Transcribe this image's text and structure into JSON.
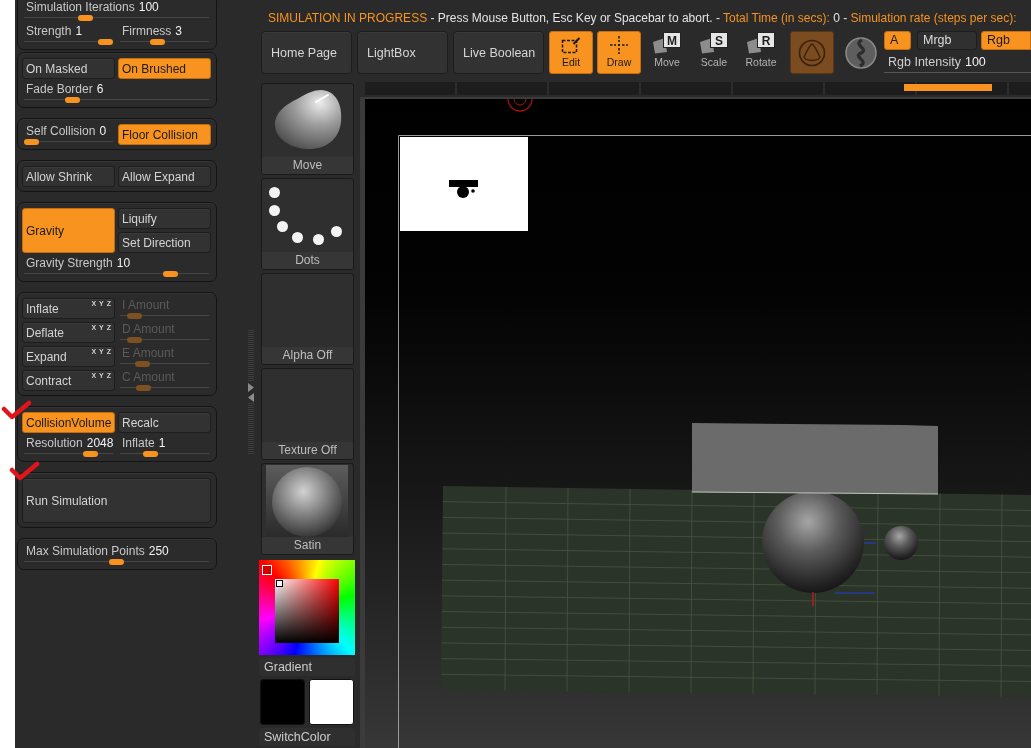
{
  "status_message": [
    {
      "text": "SIMULATION IN PROGRESS",
      "kind": "highlight"
    },
    {
      "text": "- Press Mouse Button, Esc Key or Spacebar to abort. -",
      "kind": "plain"
    },
    {
      "text": "Total Time (in secs):",
      "kind": "highlight"
    },
    {
      "text": "0 -",
      "kind": "plain"
    },
    {
      "text": "Simulation rate (steps per sec):",
      "kind": "highlight"
    }
  ],
  "toolbar": [
    {
      "kind": "link",
      "label": "Home Page"
    },
    {
      "kind": "link",
      "label": "LightBox"
    },
    {
      "kind": "link",
      "label": "Live Boolean"
    },
    {
      "kind": "edit",
      "label": "Edit",
      "selected": true
    },
    {
      "kind": "draw",
      "label": "Draw",
      "selected": true
    },
    {
      "kind": "transform",
      "label": "Move",
      "key": "M",
      "selected": false
    },
    {
      "kind": "transform",
      "label": "Scale",
      "key": "S",
      "selected": false
    },
    {
      "kind": "transform",
      "label": "Rotate",
      "key": "R",
      "selected": false
    },
    {
      "kind": "toggle",
      "selected": true,
      "disabled": true
    },
    {
      "kind": "orb"
    }
  ],
  "color_channels": [
    {
      "label": "A",
      "selected": true
    },
    {
      "label": "Mrgb",
      "selected": false
    },
    {
      "label": "Rgb",
      "selected": true
    }
  ],
  "rgb_intensity": {
    "label": "Rgb Intensity",
    "value": "100"
  },
  "panel_groups": [
    {
      "rows": [
        [
          {
            "kind": "slider",
            "label": "Simulation Iterations",
            "value": "100",
            "level": 0.32,
            "disabled": false
          }
        ],
        [
          {
            "kind": "slider",
            "label": "Strength",
            "value": "1",
            "level": 1,
            "disabled": false
          },
          {
            "kind": "slider",
            "label": "Firmness",
            "value": "3",
            "level": 0.4,
            "disabled": false
          }
        ]
      ]
    },
    {
      "rows": [
        [
          {
            "kind": "button",
            "label": "On Masked",
            "selected": false,
            "marked": false
          },
          {
            "kind": "button",
            "label": "On Brushed",
            "selected": true,
            "marked": false
          }
        ],
        [
          {
            "kind": "slider",
            "label": "Fade Border",
            "value": "6",
            "level": 0.24,
            "disabled": false
          }
        ]
      ]
    },
    {
      "rows": [
        [
          {
            "kind": "slider",
            "label": "Self Collision",
            "value": "0",
            "level": 0,
            "disabled": false
          },
          {
            "kind": "button",
            "label": "Floor Collision",
            "selected": true,
            "marked": false
          }
        ]
      ]
    },
    {
      "rows": [
        [
          {
            "kind": "button",
            "label": "Allow Shrink",
            "selected": false,
            "marked": false
          },
          {
            "kind": "button",
            "label": "Allow Expand",
            "selected": false,
            "marked": false
          }
        ]
      ]
    },
    {
      "rows": [
        [
          {
            "kind": "button",
            "label": "Gravity",
            "selected": true,
            "marked": false
          },
          {
            "kind": "stack",
            "items": [
              {
                "kind": "button",
                "label": "Liquify",
                "selected": false,
                "marked": false
              },
              {
                "kind": "button",
                "label": "Set Direction",
                "selected": false,
                "marked": false
              }
            ]
          }
        ],
        [
          {
            "kind": "slider",
            "label": "Gravity Strength",
            "value": "10",
            "level": 0.82,
            "disabled": false
          }
        ]
      ]
    },
    {
      "rows": [
        [
          {
            "kind": "axis",
            "label": "Inflate",
            "axes": [
              "X",
              "Y",
              "Z"
            ],
            "selected": false
          },
          {
            "kind": "slider",
            "label": "I Amount",
            "level": 0.1,
            "disabled": true
          }
        ],
        [
          {
            "kind": "axis",
            "label": "Deflate",
            "axes": [
              "X",
              "Y",
              "Z"
            ],
            "selected": false
          },
          {
            "kind": "slider",
            "label": "D Amount",
            "level": 0.1,
            "disabled": true
          }
        ],
        [
          {
            "kind": "axis",
            "label": "Expand",
            "axes": [
              "X",
              "Y",
              "Z"
            ],
            "selected": false
          },
          {
            "kind": "slider",
            "label": "E Amount",
            "level": 0.2,
            "disabled": true
          }
        ],
        [
          {
            "kind": "axis",
            "label": "Contract",
            "axes": [
              "X",
              "Y",
              "Z"
            ],
            "selected": false
          },
          {
            "kind": "slider",
            "label": "C Amount",
            "level": 0.21,
            "disabled": true
          }
        ]
      ]
    },
    {
      "rows": [
        [
          {
            "kind": "button",
            "label": "CollisionVolume",
            "selected": true,
            "marked": true
          },
          {
            "kind": "button",
            "label": "Recalc",
            "selected": false,
            "marked": false
          }
        ],
        [
          {
            "kind": "slider",
            "label": "Resolution",
            "value": "2048",
            "level": 0.8,
            "disabled": false
          },
          {
            "kind": "slider",
            "label": "Inflate",
            "value": "1",
            "level": 0.31,
            "disabled": false
          }
        ]
      ]
    },
    {
      "rows": [
        [
          {
            "kind": "large",
            "label": "Run Simulation",
            "selected": false,
            "marked": true
          }
        ]
      ]
    },
    {
      "rows": [
        [
          {
            "kind": "slider",
            "label": "Max Simulation Points",
            "value": "250",
            "level": 0.5,
            "disabled": false
          }
        ]
      ]
    }
  ],
  "palette_tiles": [
    {
      "kind": "brush",
      "label": "Move"
    },
    {
      "kind": "stroke",
      "label": "Dots"
    },
    {
      "kind": "alpha",
      "label": "Alpha Off"
    },
    {
      "kind": "texture",
      "label": "Texture Off"
    },
    {
      "kind": "material",
      "label": "Satin"
    }
  ],
  "color_panel": {
    "gradient_label": "Gradient",
    "swatches": [
      {
        "color": "#000000"
      },
      {
        "color": "#ffffff"
      }
    ],
    "switch_label": "SwitchColor"
  }
}
